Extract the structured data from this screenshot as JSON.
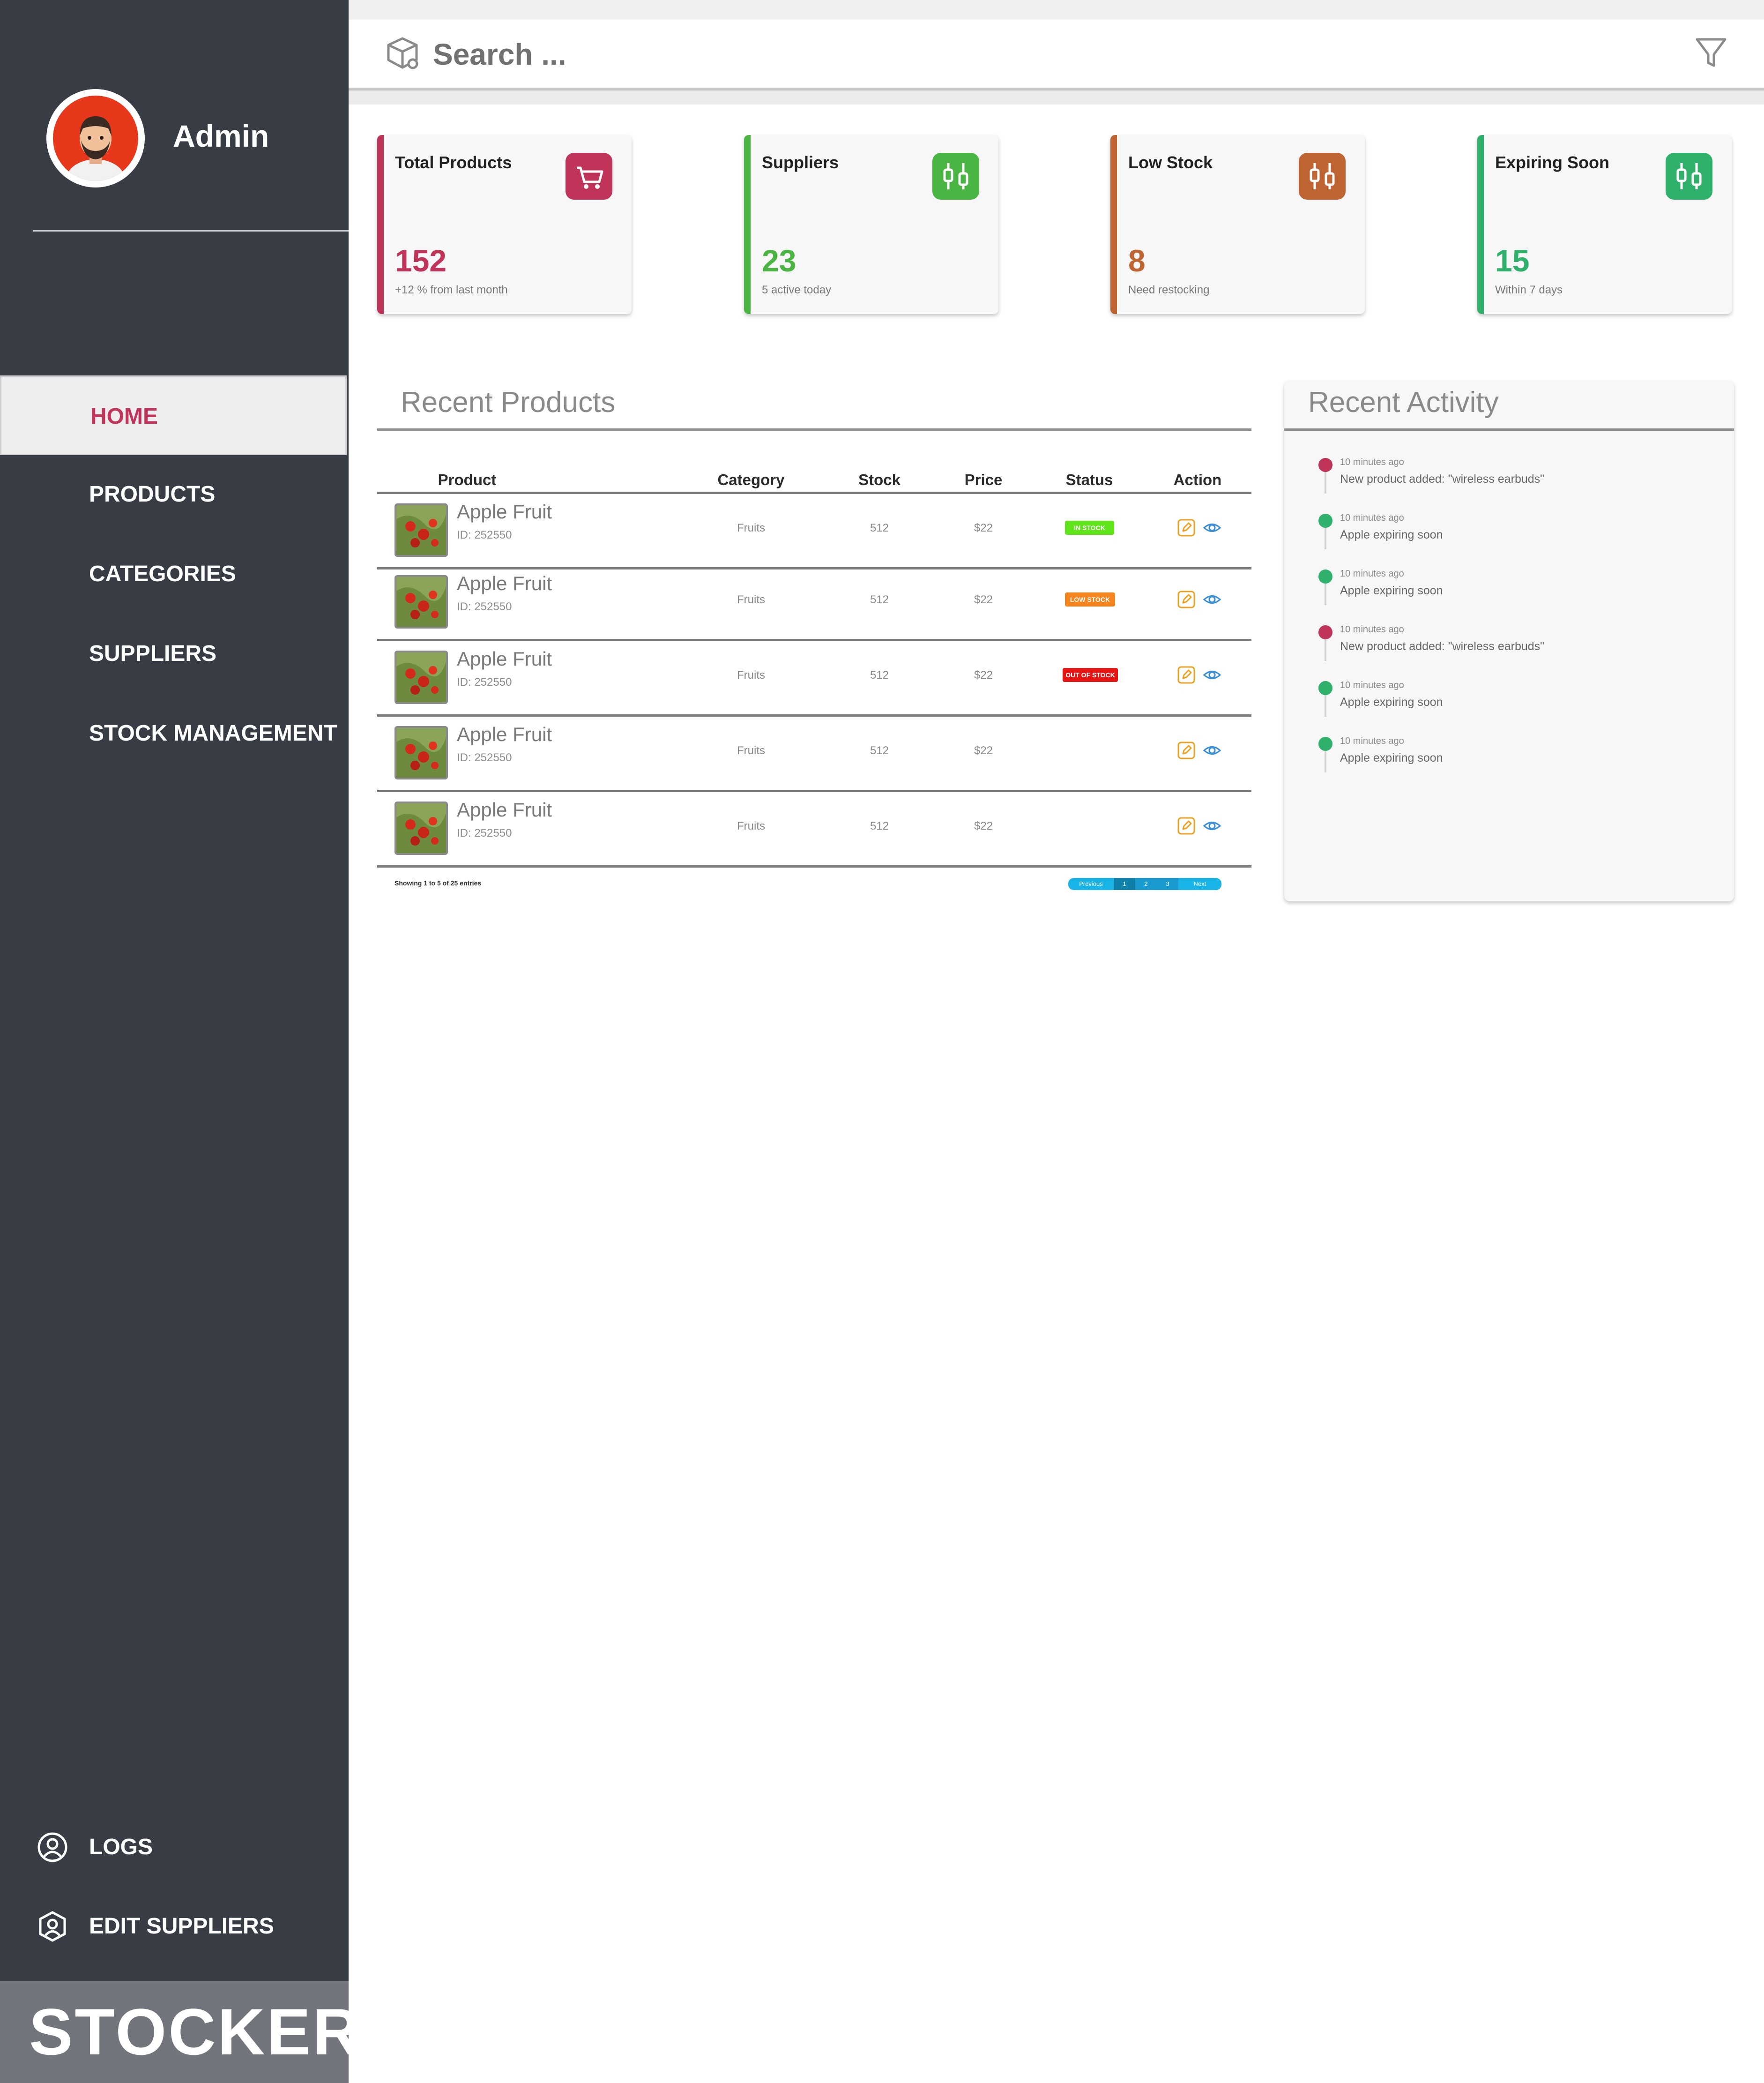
{
  "sidebar": {
    "user_name": "Admin",
    "nav": [
      {
        "label": "HOME",
        "active": true
      },
      {
        "label": "PRODUCTS",
        "active": false
      },
      {
        "label": "CATEGORIES",
        "active": false
      },
      {
        "label": "SUPPLIERS",
        "active": false
      },
      {
        "label": "STOCK MANAGEMENT",
        "active": false
      }
    ],
    "bottom": [
      {
        "label": "LOGS",
        "icon": "user-circle-icon"
      },
      {
        "label": "EDIT SUPPLIERS",
        "icon": "user-shield-icon"
      }
    ],
    "brand": "STOCKER"
  },
  "search": {
    "placeholder": "Search ...",
    "icon": "box-search-icon",
    "filter_icon": "funnel-icon"
  },
  "stats": [
    {
      "title": "Total Products",
      "value": "152",
      "sub": "+12 % from last month",
      "color": "#c0345a",
      "icon": "cart-icon"
    },
    {
      "title": "Suppliers",
      "value": "23",
      "sub": "5 active today",
      "color": "#4bb543",
      "icon": "sliders-icon"
    },
    {
      "title": "Low Stock",
      "value": "8",
      "sub": "Need restocking",
      "color": "#bf6433",
      "icon": "sliders-icon"
    },
    {
      "title": "Expiring Soon",
      "value": "15",
      "sub": "Within 7 days",
      "color": "#2fb06b",
      "icon": "sliders-icon"
    }
  ],
  "recent_products": {
    "title": "Recent Products",
    "columns": [
      "Product",
      "Category",
      "Stock",
      "Price",
      "Status",
      "Action"
    ],
    "rows": [
      {
        "name": "Apple Fruit",
        "id": "ID: 252550",
        "category": "Fruits",
        "stock": "512",
        "price": "$22",
        "status": "IN STOCK",
        "status_color": "#5fe51a"
      },
      {
        "name": "Apple Fruit",
        "id": "ID: 252550",
        "category": "Fruits",
        "stock": "512",
        "price": "$22",
        "status": "LOW STOCK",
        "status_color": "#f5861f"
      },
      {
        "name": "Apple Fruit",
        "id": "ID: 252550",
        "category": "Fruits",
        "stock": "512",
        "price": "$22",
        "status": "OUT OF STOCK",
        "status_color": "#e81414"
      },
      {
        "name": "Apple Fruit",
        "id": "ID: 252550",
        "category": "Fruits",
        "stock": "512",
        "price": "$22",
        "status": "",
        "status_color": ""
      },
      {
        "name": "Apple Fruit",
        "id": "ID: 252550",
        "category": "Fruits",
        "stock": "512",
        "price": "$22",
        "status": "",
        "status_color": ""
      }
    ],
    "showing": "Showing 1 to 5 of 25 entries",
    "pager": {
      "previous": "Previous",
      "pages": [
        "1",
        "2",
        "3"
      ],
      "next": "Next"
    }
  },
  "recent_activity": {
    "title": "Recent Activity",
    "items": [
      {
        "time": "10 minutes ago",
        "message": "New product added: \"wireless earbuds\"",
        "color": "#c0345a"
      },
      {
        "time": "10 minutes ago",
        "message": "Apple expiring soon",
        "color": "#2fb06b"
      },
      {
        "time": "10 minutes ago",
        "message": "Apple expiring soon",
        "color": "#2fb06b"
      },
      {
        "time": "10 minutes ago",
        "message": "New product added: \"wireless earbuds\"",
        "color": "#c0345a"
      },
      {
        "time": "10 minutes ago",
        "message": "Apple expiring soon",
        "color": "#2fb06b"
      },
      {
        "time": "10 minutes ago",
        "message": "Apple expiring soon",
        "color": "#2fb06b"
      }
    ]
  }
}
